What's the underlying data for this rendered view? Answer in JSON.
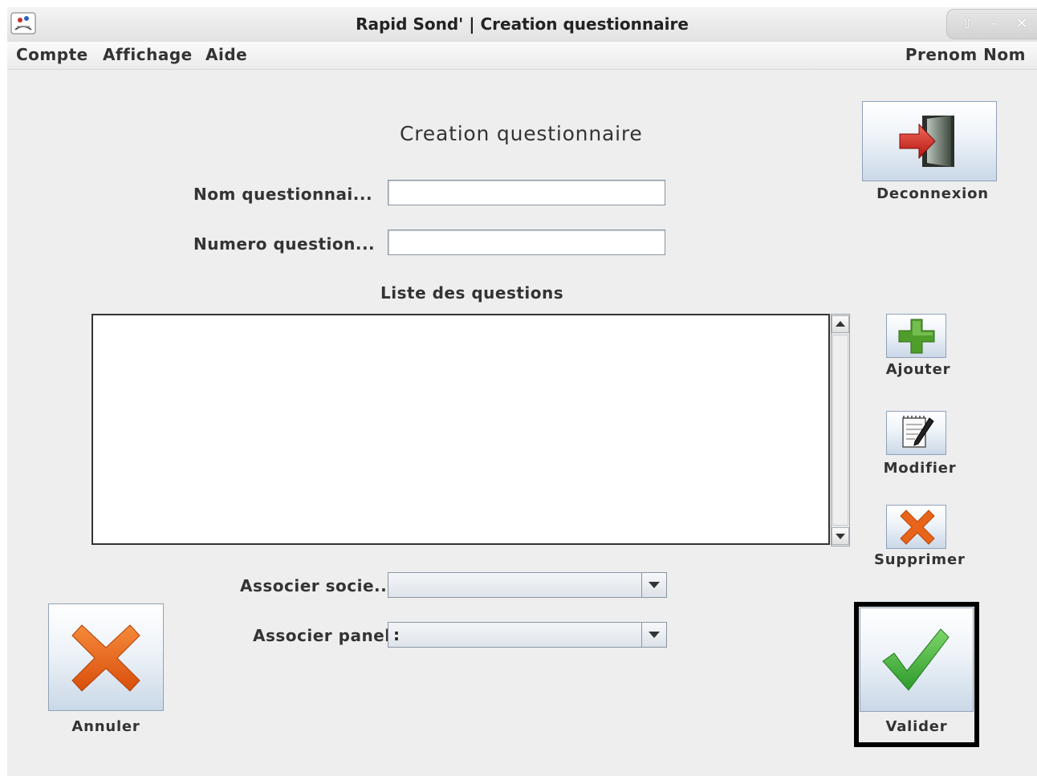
{
  "window": {
    "title": "Rapid Sond' | Creation questionnaire",
    "controls": {
      "maximize": "⇧",
      "minimize": "–",
      "close": "✕"
    }
  },
  "menu": {
    "items": [
      "Compte",
      "Affichage",
      "Aide"
    ],
    "user": "Prenom Nom"
  },
  "form": {
    "heading": "Creation questionnaire",
    "nom_label": "Nom questionnai...",
    "nom_value": "",
    "numero_label": "Numero question...",
    "numero_value": "",
    "list_label": "Liste des questions",
    "questions": [],
    "societe_label": "Associer socie...",
    "societe_selected": "",
    "panel_label": "Associer panel",
    "panel_selected": ":"
  },
  "buttons": {
    "deconnexion": "Deconnexion",
    "ajouter": "Ajouter",
    "modifier": "Modifier",
    "supprimer": "Supprimer",
    "annuler": "Annuler",
    "valider": "Valider"
  },
  "colors": {
    "add_green": "#4f9e2c",
    "delete_orange": "#e8641a",
    "check_green": "#3fae3a",
    "exit_red": "#d8261c"
  }
}
